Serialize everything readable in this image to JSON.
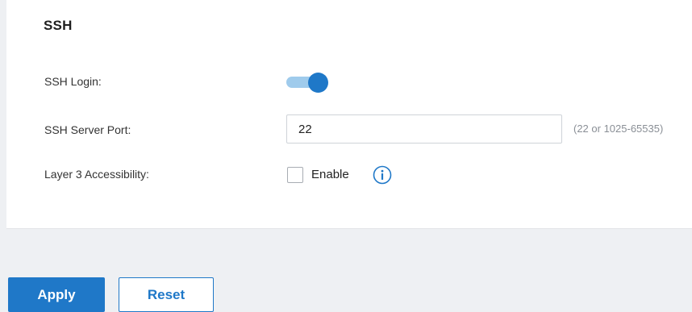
{
  "section": {
    "title": "SSH"
  },
  "ssh_login": {
    "label": "SSH Login:",
    "enabled": true
  },
  "server_port": {
    "label": "SSH Server Port:",
    "value": "22",
    "hint": "(22 or 1025-65535)"
  },
  "layer3": {
    "label": "Layer 3 Accessibility:",
    "checkbox_label": "Enable",
    "checked": false,
    "info_icon": "info-circle-icon"
  },
  "actions": {
    "apply_label": "Apply",
    "reset_label": "Reset"
  },
  "colors": {
    "accent": "#1f78c8",
    "toggle_track": "#9fcbec",
    "hint_text": "#8a8f96",
    "page_background": "#eef0f3"
  }
}
